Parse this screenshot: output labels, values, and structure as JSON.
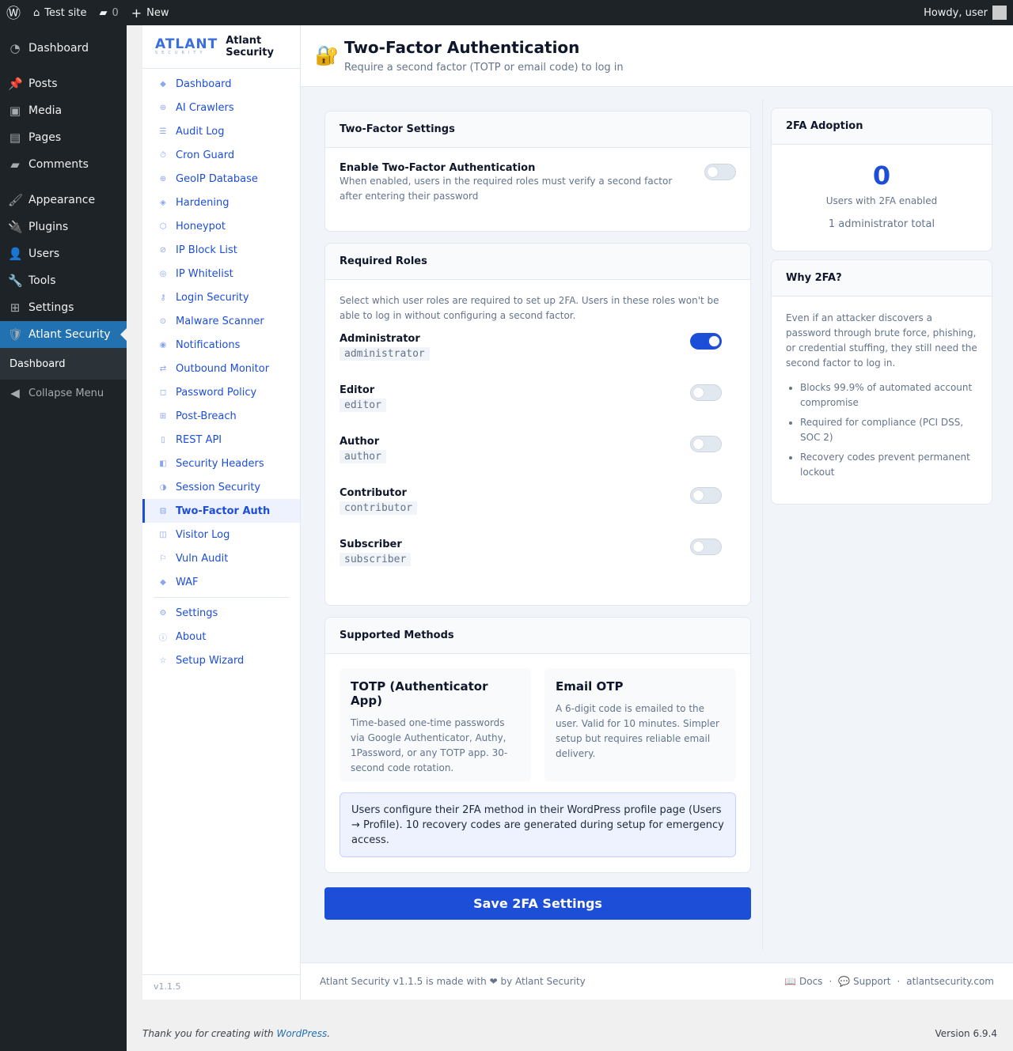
{
  "adminbar": {
    "site": "Test site",
    "comments": "0",
    "new": "New",
    "howdy": "Howdy, user"
  },
  "wpmenu": {
    "items": [
      "Dashboard",
      "Posts",
      "Media",
      "Pages",
      "Comments",
      "Appearance",
      "Plugins",
      "Users",
      "Tools",
      "Settings",
      "Atlant Security"
    ],
    "sub": "Dashboard",
    "collapse": "Collapse Menu"
  },
  "plugin": {
    "logo_mark": "ATLANT",
    "logo_sub": "SECURITY",
    "name1": "Atlant",
    "name2": "Security",
    "nav": [
      {
        "icon": "◆",
        "label": "Dashboard"
      },
      {
        "icon": "⊛",
        "label": "AI Crawlers"
      },
      {
        "icon": "☰",
        "label": "Audit Log"
      },
      {
        "icon": "⏱",
        "label": "Cron Guard"
      },
      {
        "icon": "⊕",
        "label": "GeoIP Database"
      },
      {
        "icon": "◈",
        "label": "Hardening"
      },
      {
        "icon": "⬡",
        "label": "Honeypot"
      },
      {
        "icon": "⊘",
        "label": "IP Block List"
      },
      {
        "icon": "◎",
        "label": "IP Whitelist"
      },
      {
        "icon": "⚷",
        "label": "Login Security"
      },
      {
        "icon": "⊙",
        "label": "Malware Scanner"
      },
      {
        "icon": "◉",
        "label": "Notifications"
      },
      {
        "icon": "⇄",
        "label": "Outbound Monitor"
      },
      {
        "icon": "◻",
        "label": "Password Policy"
      },
      {
        "icon": "⊞",
        "label": "Post-Breach"
      },
      {
        "icon": "▯",
        "label": "REST API"
      },
      {
        "icon": "◧",
        "label": "Security Headers"
      },
      {
        "icon": "◑",
        "label": "Session Security"
      },
      {
        "icon": "⊟",
        "label": "Two-Factor Auth"
      },
      {
        "icon": "◫",
        "label": "Visitor Log"
      },
      {
        "icon": "⚐",
        "label": "Vuln Audit"
      },
      {
        "icon": "◆",
        "label": "WAF"
      }
    ],
    "nav2": [
      {
        "icon": "⚙",
        "label": "Settings"
      },
      {
        "icon": "ⓘ",
        "label": "About"
      },
      {
        "icon": "☆",
        "label": "Setup Wizard"
      }
    ],
    "version": "v1.1.5"
  },
  "header": {
    "title": "Two-Factor Authentication",
    "subtitle": "Require a second factor (TOTP or email code) to log in"
  },
  "settings": {
    "title": "Two-Factor Settings",
    "enable_label": "Enable Two-Factor Authentication",
    "enable_desc": "When enabled, users in the required roles must verify a second factor after entering their password",
    "enabled": false
  },
  "roles": {
    "title": "Required Roles",
    "desc": "Select which user roles are required to set up 2FA. Users in these roles won't be able to log in without configuring a second factor.",
    "items": [
      {
        "name": "Administrator",
        "slug": "administrator",
        "on": true
      },
      {
        "name": "Editor",
        "slug": "editor",
        "on": false
      },
      {
        "name": "Author",
        "slug": "author",
        "on": false
      },
      {
        "name": "Contributor",
        "slug": "contributor",
        "on": false
      },
      {
        "name": "Subscriber",
        "slug": "subscriber",
        "on": false
      }
    ]
  },
  "methods": {
    "title": "Supported Methods",
    "totp_title": "TOTP (Authenticator App)",
    "totp_desc": "Time-based one-time passwords via Google Authenticator, Authy, 1Password, or any TOTP app. 30-second code rotation.",
    "email_title": "Email OTP",
    "email_desc": "A 6-digit code is emailed to the user. Valid for 10 minutes. Simpler setup but requires reliable email delivery.",
    "note": "Users configure their 2FA method in their WordPress profile page (Users → Profile). 10 recovery codes are generated during setup for emergency access."
  },
  "save_label": "Save 2FA Settings",
  "adoption": {
    "title": "2FA Adoption",
    "count": "0",
    "label": "Users with 2FA enabled",
    "total": "1 administrator total"
  },
  "why": {
    "title": "Why 2FA?",
    "text": "Even if an attacker discovers a password through brute force, phishing, or credential stuffing, they still need the second factor to log in.",
    "bullets": [
      "Blocks 99.9% of automated account compromise",
      "Required for compliance (PCI DSS, SOC 2)",
      "Recovery codes prevent permanent lockout"
    ]
  },
  "pfooter": {
    "text": "Atlant Security v1.1.5 is made with ❤ by Atlant Security",
    "docs": "📖 Docs",
    "support": "💬 Support",
    "site": "atlantsecurity.com",
    "sep": "·"
  },
  "wpfooter": {
    "thanks": "Thank you for creating with ",
    "wp": "WordPress",
    "version": "Version 6.9.4"
  }
}
